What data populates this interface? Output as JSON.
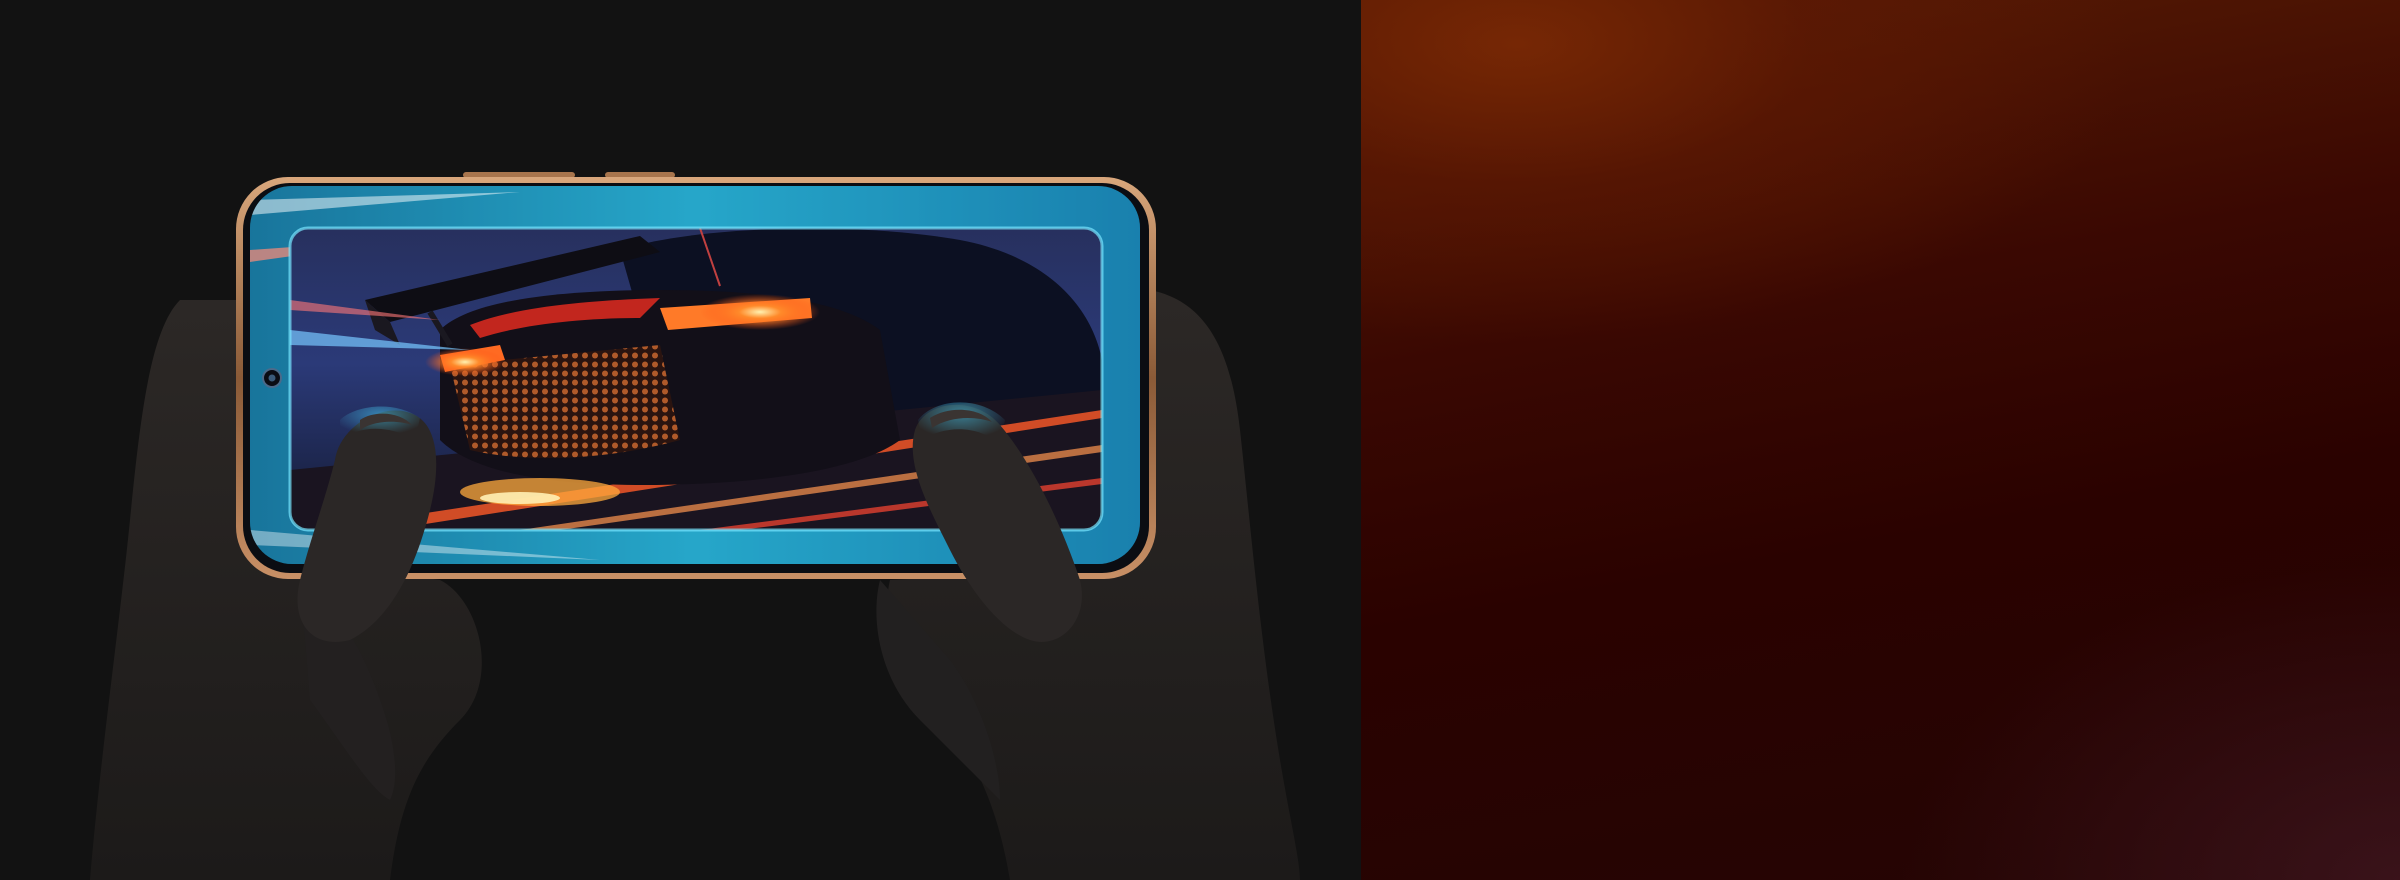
{
  "scene": {
    "subject": "phone-held-landscape-playing-racing-game",
    "icons": {
      "camera": "front-camera-icon"
    },
    "colors": {
      "left_background": "#121212",
      "right_background_top": "#5a1d04",
      "right_background_bottom": "#240504",
      "phone_frame": "#b7805a",
      "screen_glow": "#29c8f0",
      "tail_light": "#ff6a20",
      "skin": "#2a2624"
    }
  }
}
